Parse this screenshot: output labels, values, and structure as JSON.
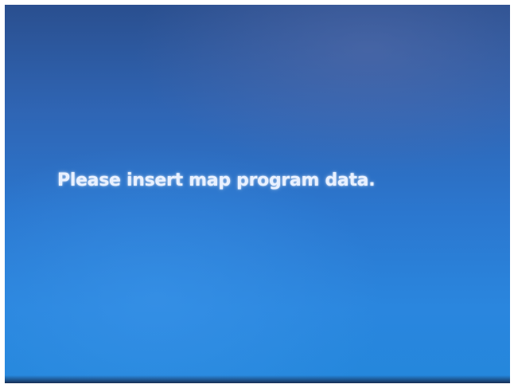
{
  "screen": {
    "message": "Please insert map program data."
  },
  "colors": {
    "background_top": "#2a4f8f",
    "background_bottom": "#2487dc",
    "text": "#e9f1ff"
  }
}
